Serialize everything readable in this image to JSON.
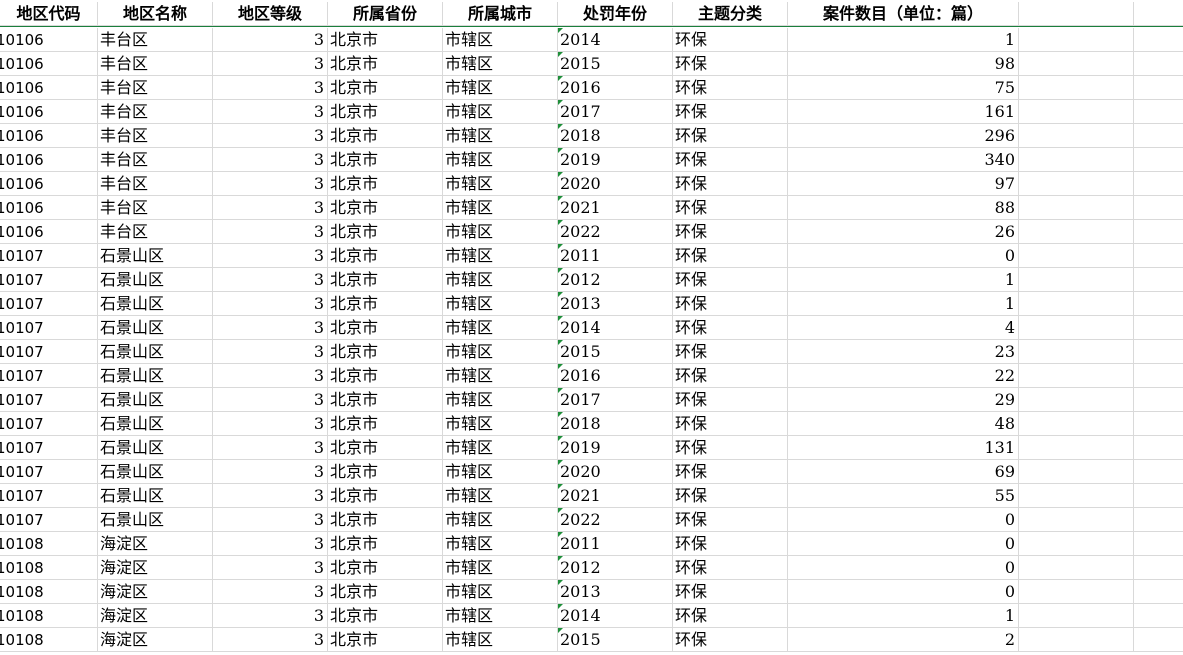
{
  "sheet": {
    "headers": [
      "地区代码",
      "地区名称",
      "地区等级",
      "所属省份",
      "所属城市",
      "处罚年份",
      "主题分类",
      "案件数目（单位：篇）"
    ],
    "rows": [
      [
        "10106",
        "丰台区",
        "3",
        "北京市",
        "市辖区",
        "2014",
        "环保",
        "1"
      ],
      [
        "10106",
        "丰台区",
        "3",
        "北京市",
        "市辖区",
        "2015",
        "环保",
        "98"
      ],
      [
        "10106",
        "丰台区",
        "3",
        "北京市",
        "市辖区",
        "2016",
        "环保",
        "75"
      ],
      [
        "10106",
        "丰台区",
        "3",
        "北京市",
        "市辖区",
        "2017",
        "环保",
        "161"
      ],
      [
        "10106",
        "丰台区",
        "3",
        "北京市",
        "市辖区",
        "2018",
        "环保",
        "296"
      ],
      [
        "10106",
        "丰台区",
        "3",
        "北京市",
        "市辖区",
        "2019",
        "环保",
        "340"
      ],
      [
        "10106",
        "丰台区",
        "3",
        "北京市",
        "市辖区",
        "2020",
        "环保",
        "97"
      ],
      [
        "10106",
        "丰台区",
        "3",
        "北京市",
        "市辖区",
        "2021",
        "环保",
        "88"
      ],
      [
        "10106",
        "丰台区",
        "3",
        "北京市",
        "市辖区",
        "2022",
        "环保",
        "26"
      ],
      [
        "10107",
        "石景山区",
        "3",
        "北京市",
        "市辖区",
        "2011",
        "环保",
        "0"
      ],
      [
        "10107",
        "石景山区",
        "3",
        "北京市",
        "市辖区",
        "2012",
        "环保",
        "1"
      ],
      [
        "10107",
        "石景山区",
        "3",
        "北京市",
        "市辖区",
        "2013",
        "环保",
        "1"
      ],
      [
        "10107",
        "石景山区",
        "3",
        "北京市",
        "市辖区",
        "2014",
        "环保",
        "4"
      ],
      [
        "10107",
        "石景山区",
        "3",
        "北京市",
        "市辖区",
        "2015",
        "环保",
        "23"
      ],
      [
        "10107",
        "石景山区",
        "3",
        "北京市",
        "市辖区",
        "2016",
        "环保",
        "22"
      ],
      [
        "10107",
        "石景山区",
        "3",
        "北京市",
        "市辖区",
        "2017",
        "环保",
        "29"
      ],
      [
        "10107",
        "石景山区",
        "3",
        "北京市",
        "市辖区",
        "2018",
        "环保",
        "48"
      ],
      [
        "10107",
        "石景山区",
        "3",
        "北京市",
        "市辖区",
        "2019",
        "环保",
        "131"
      ],
      [
        "10107",
        "石景山区",
        "3",
        "北京市",
        "市辖区",
        "2020",
        "环保",
        "69"
      ],
      [
        "10107",
        "石景山区",
        "3",
        "北京市",
        "市辖区",
        "2021",
        "环保",
        "55"
      ],
      [
        "10107",
        "石景山区",
        "3",
        "北京市",
        "市辖区",
        "2022",
        "环保",
        "0"
      ],
      [
        "10108",
        "海淀区",
        "3",
        "北京市",
        "市辖区",
        "2011",
        "环保",
        "0"
      ],
      [
        "10108",
        "海淀区",
        "3",
        "北京市",
        "市辖区",
        "2012",
        "环保",
        "0"
      ],
      [
        "10108",
        "海淀区",
        "3",
        "北京市",
        "市辖区",
        "2013",
        "环保",
        "0"
      ],
      [
        "10108",
        "海淀区",
        "3",
        "北京市",
        "市辖区",
        "2014",
        "环保",
        "1"
      ],
      [
        "10108",
        "海淀区",
        "3",
        "北京市",
        "市辖区",
        "2015",
        "环保",
        "2"
      ]
    ]
  },
  "colors": {
    "grid": "#d9d9d9",
    "text_number_flag": "#1f8f3a",
    "header_border": "#1a7f3c"
  }
}
